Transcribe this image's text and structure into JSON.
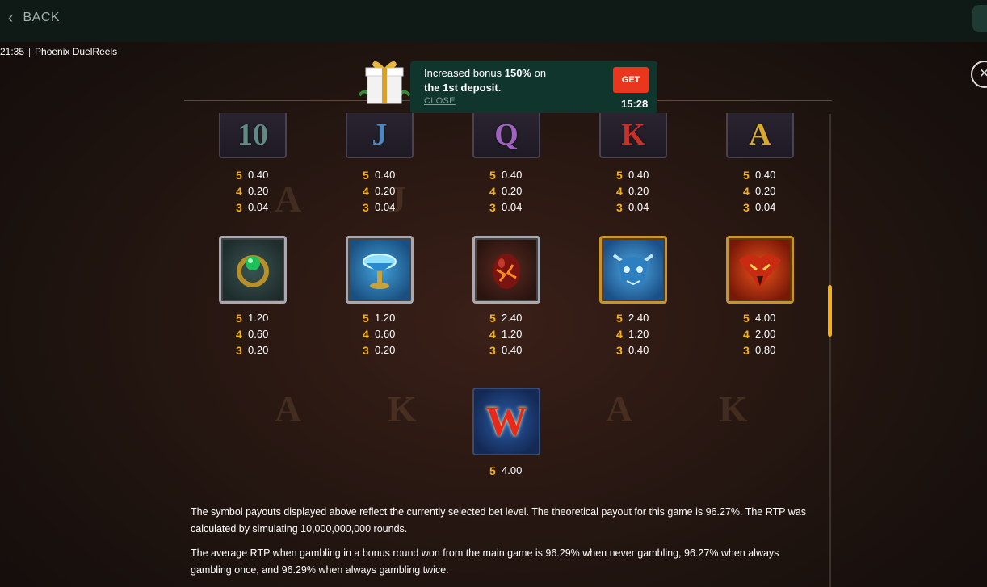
{
  "topbar": {
    "back_label": "BACK"
  },
  "status": {
    "time": "21:35",
    "game_title": "Phoenix DuelReels"
  },
  "promo": {
    "text_prefix": "Increased bonus ",
    "text_bold": "150%",
    "text_mid": " on",
    "text_line2": "the 1st deposit.",
    "close_label": "CLOSE",
    "get_label": "GET",
    "timer": "15:28"
  },
  "paytable": {
    "row1": [
      {
        "symbol": "10",
        "color": "#5f8a85",
        "pays": [
          [
            "5",
            "0.40"
          ],
          [
            "4",
            "0.20"
          ],
          [
            "3",
            "0.04"
          ]
        ]
      },
      {
        "symbol": "J",
        "color": "#4e86c0",
        "pays": [
          [
            "5",
            "0.40"
          ],
          [
            "4",
            "0.20"
          ],
          [
            "3",
            "0.04"
          ]
        ]
      },
      {
        "symbol": "Q",
        "color": "#a062c0",
        "pays": [
          [
            "5",
            "0.40"
          ],
          [
            "4",
            "0.20"
          ],
          [
            "3",
            "0.04"
          ]
        ]
      },
      {
        "symbol": "K",
        "color": "#c8302a",
        "pays": [
          [
            "5",
            "0.40"
          ],
          [
            "4",
            "0.20"
          ],
          [
            "3",
            "0.04"
          ]
        ]
      },
      {
        "symbol": "A",
        "color": "#d9a932",
        "pays": [
          [
            "5",
            "0.40"
          ],
          [
            "4",
            "0.20"
          ],
          [
            "3",
            "0.04"
          ]
        ]
      }
    ],
    "row2": [
      {
        "symbol": "green-ring-icon",
        "pays": [
          [
            "5",
            "1.20"
          ],
          [
            "4",
            "0.60"
          ],
          [
            "3",
            "0.20"
          ]
        ]
      },
      {
        "symbol": "blue-chalice-icon",
        "pays": [
          [
            "5",
            "1.20"
          ],
          [
            "4",
            "0.60"
          ],
          [
            "3",
            "0.20"
          ]
        ]
      },
      {
        "symbol": "dragon-egg-icon",
        "pays": [
          [
            "5",
            "2.40"
          ],
          [
            "4",
            "1.20"
          ],
          [
            "3",
            "0.40"
          ]
        ]
      },
      {
        "symbol": "blue-dragon-icon",
        "pays": [
          [
            "5",
            "2.40"
          ],
          [
            "4",
            "1.20"
          ],
          [
            "3",
            "0.40"
          ]
        ]
      },
      {
        "symbol": "phoenix-icon",
        "pays": [
          [
            "5",
            "4.00"
          ],
          [
            "4",
            "2.00"
          ],
          [
            "3",
            "0.80"
          ]
        ]
      }
    ],
    "wild": {
      "symbol": "W",
      "pays": [
        [
          "5",
          "4.00"
        ]
      ]
    }
  },
  "description": {
    "p1": "The symbol payouts displayed above reflect the currently selected bet level. The theoretical payout for this game is 96.27%. The RTP was calculated by simulating 10,000,000,000 rounds.",
    "p2": "The average RTP when gambling in a bonus round won from the main game is 96.29% when never gambling, 96.27% when always gambling once, and 96.29% when always gambling twice."
  },
  "scrollbar": {
    "position_fraction": 0.36
  }
}
